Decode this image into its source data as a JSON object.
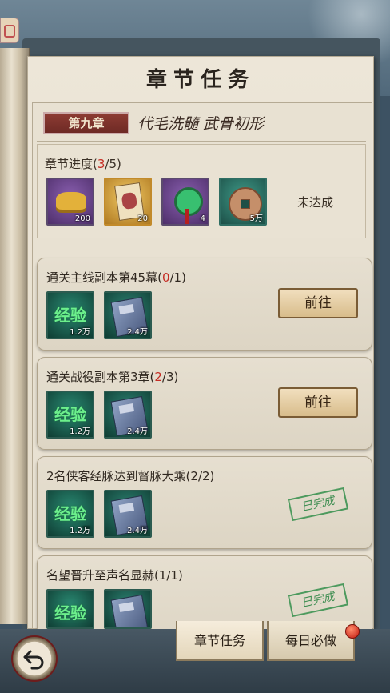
{
  "page": {
    "title": "章节任务"
  },
  "chapter": {
    "tag": "第九章",
    "subtitle": "代毛洗髓 武骨初形"
  },
  "progress": {
    "label": "章节进度(",
    "current": "3",
    "rest": "/5)",
    "status": "未达成",
    "rewards": [
      {
        "icon": "gold-ingot-icon",
        "qty": "200"
      },
      {
        "icon": "hero-card-icon",
        "qty": "20"
      },
      {
        "icon": "jade-pendant-icon",
        "qty": "4"
      },
      {
        "icon": "copper-coin-icon",
        "qty": "5万"
      }
    ]
  },
  "tasks": [
    {
      "title_prefix": "通关主线副本第45幕(",
      "progress_current": "0",
      "title_suffix": "/1)",
      "state": "go",
      "button_label": "前往",
      "rewards": [
        {
          "label": "经验",
          "qty": "1.2万"
        },
        {
          "icon": "book-icon",
          "qty": "2.4万"
        }
      ]
    },
    {
      "title_prefix": "通关战役副本第3章(",
      "progress_current": "2",
      "title_suffix": "/3)",
      "state": "go",
      "button_label": "前往",
      "rewards": [
        {
          "label": "经验",
          "qty": "1.2万"
        },
        {
          "icon": "book-icon",
          "qty": "2.4万"
        }
      ]
    },
    {
      "title": "2名侠客经脉达到督脉大乘(2/2)",
      "state": "done",
      "stamp": "已完成",
      "rewards": [
        {
          "label": "经验",
          "qty": "1.2万"
        },
        {
          "icon": "book-icon",
          "qty": "2.4万"
        }
      ]
    },
    {
      "title": "名望晋升至声名显赫(1/1)",
      "state": "done",
      "stamp": "已完成",
      "rewards": [
        {
          "label": "经验"
        },
        {
          "icon": "book-icon"
        }
      ]
    }
  ],
  "bottom": {
    "tabs": [
      {
        "label": "章节任务"
      },
      {
        "label": "每日必做"
      }
    ]
  },
  "colors": {
    "accent_red": "#c52c23",
    "paper": "#e8e1d2",
    "done_green": "#3f8e52"
  }
}
